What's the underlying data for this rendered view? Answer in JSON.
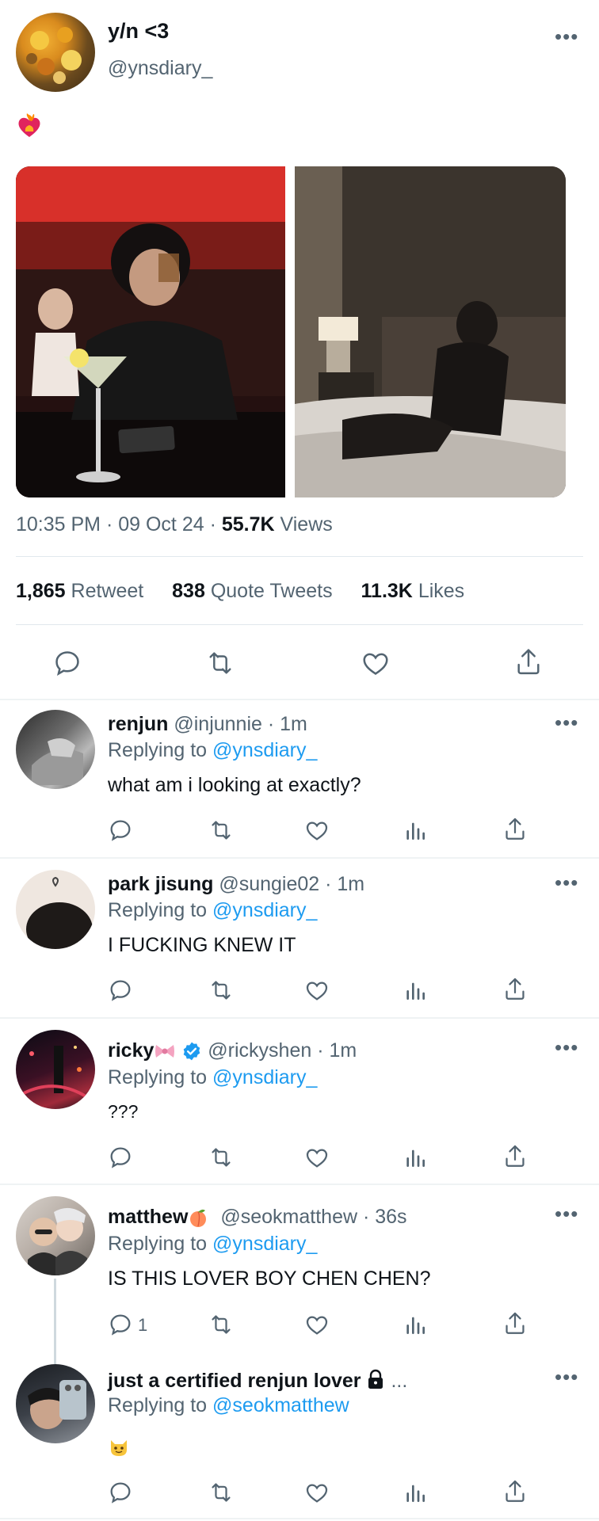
{
  "main_tweet": {
    "display_name": "y/n <3",
    "handle": "@ynsdiary_",
    "timestamp": "10:35 PM · 09 Oct 24 · ",
    "views_count": "55.7K",
    "views_label": " Views",
    "retweets_count": "1,865",
    "retweets_label": "Retweet",
    "quotes_count": "838",
    "quotes_label": "Quote Tweets",
    "likes_count": "11.3K",
    "likes_label": "Likes"
  },
  "replies": [
    {
      "display_name": "renjun",
      "handle": "@injunnie · 1m",
      "replying_prefix": "Replying to ",
      "replying_to": "@ynsdiary_",
      "text": "what am i looking at exactly?",
      "reply_count": ""
    },
    {
      "display_name": "park jisung",
      "handle": "@sungie02 · 1m",
      "replying_prefix": "Replying to ",
      "replying_to": "@ynsdiary_",
      "text": "I FUCKING KNEW IT",
      "reply_count": ""
    },
    {
      "display_name": "ricky",
      "handle": "@rickyshen · 1m",
      "replying_prefix": "Replying to ",
      "replying_to": "@ynsdiary_",
      "text": "???",
      "reply_count": ""
    },
    {
      "display_name": "matthew",
      "handle": "@seokmatthew · 36s",
      "replying_prefix": "Replying to ",
      "replying_to": "@ynsdiary_",
      "text": "IS THIS LOVER BOY CHEN CHEN?",
      "reply_count": "1"
    },
    {
      "display_name": "just a certified renjun lover",
      "handle": "...",
      "replying_prefix": "Replying to ",
      "replying_to": "@seokmatthew",
      "text": "",
      "reply_count": ""
    }
  ],
  "colors": {
    "accent": "#1d9bf0",
    "muted": "#536471",
    "text": "#0f1419",
    "verified": "#1d9bf0"
  },
  "icons": [
    "more-icon",
    "reply-icon",
    "retweet-icon",
    "like-icon",
    "share-icon",
    "views-icon",
    "verified-badge-icon",
    "lock-icon",
    "heart-fire-emoji",
    "ribbon-emoji",
    "peach-emoji",
    "cat-emoji"
  ]
}
